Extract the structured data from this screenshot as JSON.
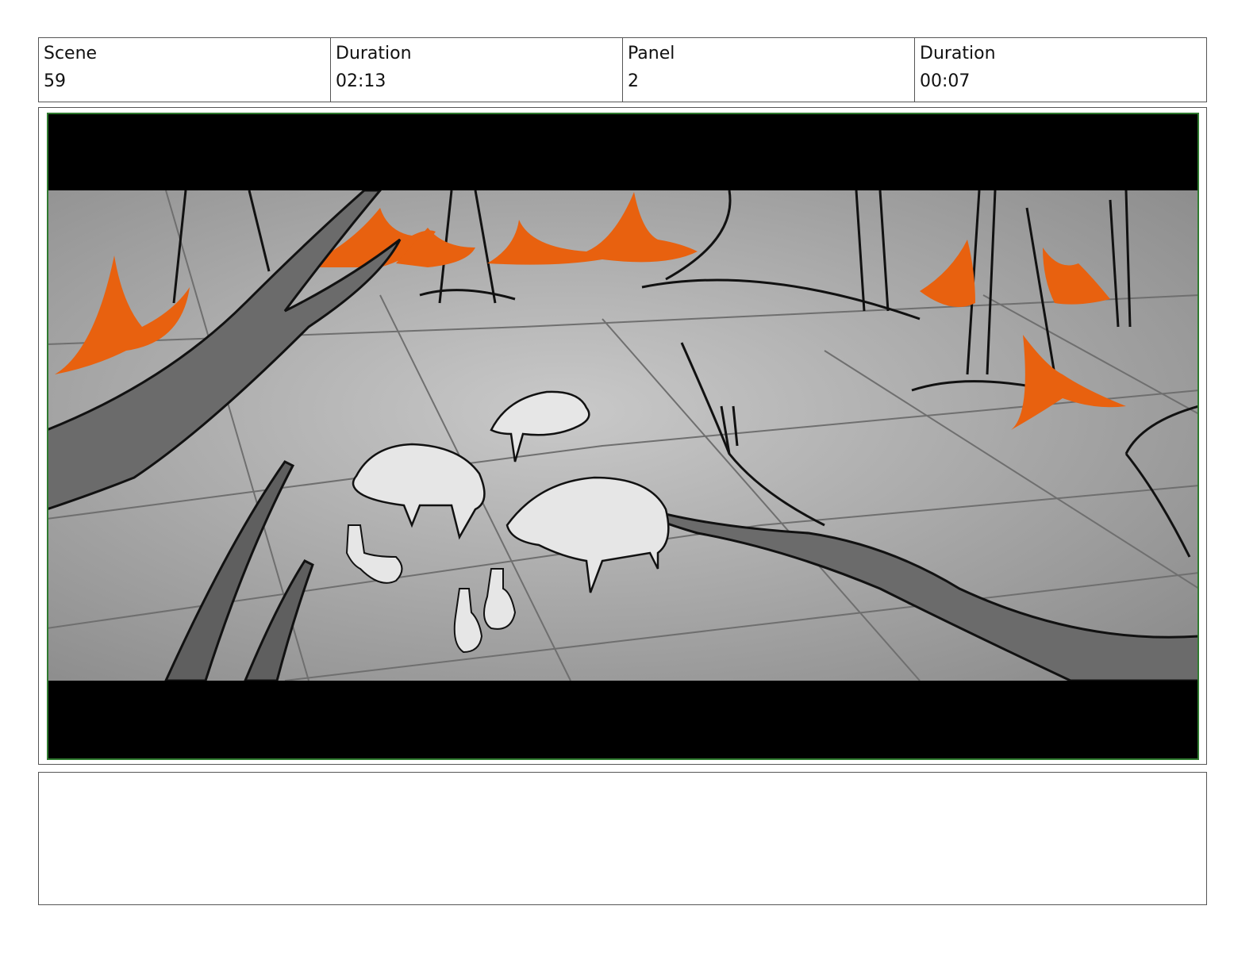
{
  "header": {
    "scene_label": "Scene",
    "scene_value": "59",
    "scene_duration_label": "Duration",
    "scene_duration_value": "02:13",
    "panel_label": "Panel",
    "panel_value": "2",
    "panel_duration_label": "Duration",
    "panel_duration_value": "00:07"
  },
  "panel_image": {
    "subject": "sketch-forest-clearing-boars-rabbits",
    "colors": {
      "letterbox": "#000000",
      "frame_border": "#2f7a2f",
      "ground": "#9a9a9a",
      "fire": "#e8610f",
      "branch": "#6a6a6a"
    }
  },
  "notes": {
    "text": ""
  }
}
